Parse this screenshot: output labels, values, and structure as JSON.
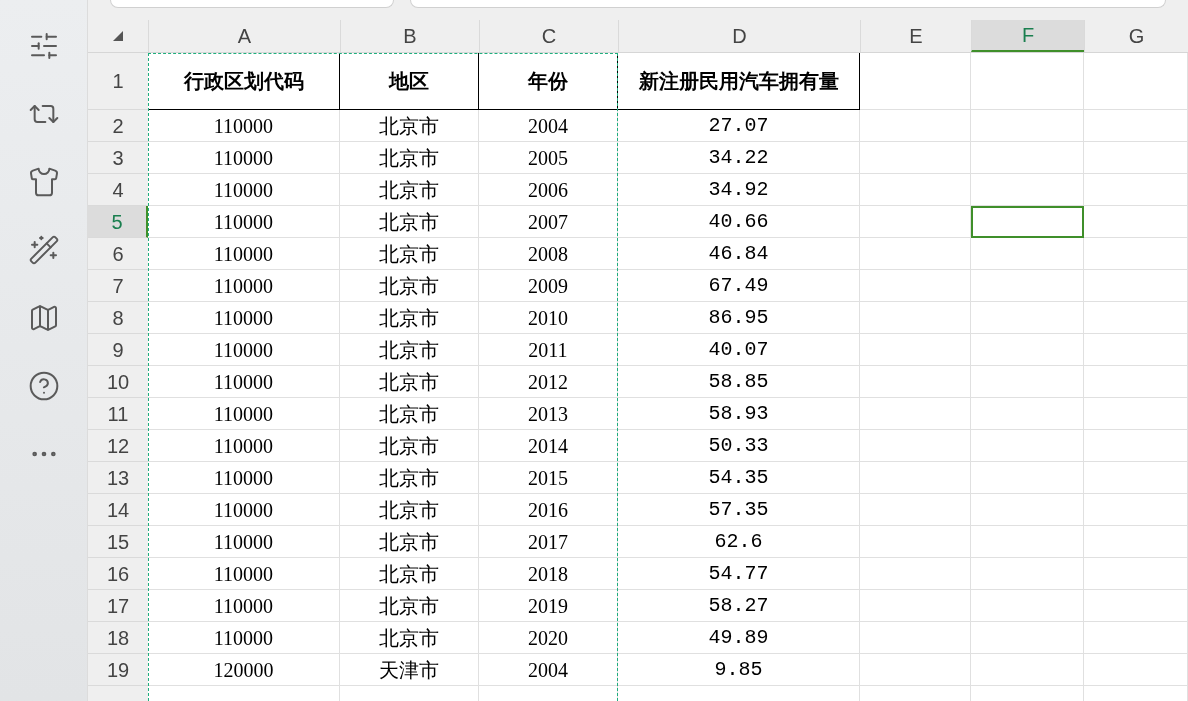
{
  "columns": [
    {
      "label": "A",
      "selected": false,
      "in_copy_range": true
    },
    {
      "label": "B",
      "selected": false,
      "in_copy_range": true
    },
    {
      "label": "C",
      "selected": false,
      "in_copy_range": true
    },
    {
      "label": "D",
      "selected": false,
      "in_copy_range": false
    },
    {
      "label": "E",
      "selected": false,
      "in_copy_range": false
    },
    {
      "label": "F",
      "selected": true,
      "in_copy_range": false
    },
    {
      "label": "G",
      "selected": false,
      "in_copy_range": false
    }
  ],
  "rows": [
    {
      "number": "1",
      "kind": "header",
      "selected": false,
      "cells": [
        "行政区划代码",
        "地区",
        "年份",
        "新注册民用汽车拥有量"
      ]
    },
    {
      "number": "2",
      "kind": "data",
      "selected": false,
      "cells": [
        "110000",
        "北京市",
        "2004",
        "27.07"
      ]
    },
    {
      "number": "3",
      "kind": "data",
      "selected": false,
      "cells": [
        "110000",
        "北京市",
        "2005",
        "34.22"
      ]
    },
    {
      "number": "4",
      "kind": "data",
      "selected": false,
      "cells": [
        "110000",
        "北京市",
        "2006",
        "34.92"
      ]
    },
    {
      "number": "5",
      "kind": "data",
      "selected": true,
      "cells": [
        "110000",
        "北京市",
        "2007",
        "40.66"
      ]
    },
    {
      "number": "6",
      "kind": "data",
      "selected": false,
      "cells": [
        "110000",
        "北京市",
        "2008",
        "46.84"
      ]
    },
    {
      "number": "7",
      "kind": "data",
      "selected": false,
      "cells": [
        "110000",
        "北京市",
        "2009",
        "67.49"
      ]
    },
    {
      "number": "8",
      "kind": "data",
      "selected": false,
      "cells": [
        "110000",
        "北京市",
        "2010",
        "86.95"
      ]
    },
    {
      "number": "9",
      "kind": "data",
      "selected": false,
      "cells": [
        "110000",
        "北京市",
        "2011",
        "40.07"
      ]
    },
    {
      "number": "10",
      "kind": "data",
      "selected": false,
      "cells": [
        "110000",
        "北京市",
        "2012",
        "58.85"
      ]
    },
    {
      "number": "11",
      "kind": "data",
      "selected": false,
      "cells": [
        "110000",
        "北京市",
        "2013",
        "58.93"
      ]
    },
    {
      "number": "12",
      "kind": "data",
      "selected": false,
      "cells": [
        "110000",
        "北京市",
        "2014",
        "50.33"
      ]
    },
    {
      "number": "13",
      "kind": "data",
      "selected": false,
      "cells": [
        "110000",
        "北京市",
        "2015",
        "54.35"
      ]
    },
    {
      "number": "14",
      "kind": "data",
      "selected": false,
      "cells": [
        "110000",
        "北京市",
        "2016",
        "57.35"
      ]
    },
    {
      "number": "15",
      "kind": "data",
      "selected": false,
      "cells": [
        "110000",
        "北京市",
        "2017",
        "62.6"
      ]
    },
    {
      "number": "16",
      "kind": "data",
      "selected": false,
      "cells": [
        "110000",
        "北京市",
        "2018",
        "54.77"
      ]
    },
    {
      "number": "17",
      "kind": "data",
      "selected": false,
      "cells": [
        "110000",
        "北京市",
        "2019",
        "58.27"
      ]
    },
    {
      "number": "18",
      "kind": "data",
      "selected": false,
      "cells": [
        "110000",
        "北京市",
        "2020",
        "49.89"
      ]
    },
    {
      "number": "19",
      "kind": "data",
      "selected": false,
      "cells": [
        "120000",
        "天津市",
        "2004",
        "9.85"
      ]
    }
  ]
}
